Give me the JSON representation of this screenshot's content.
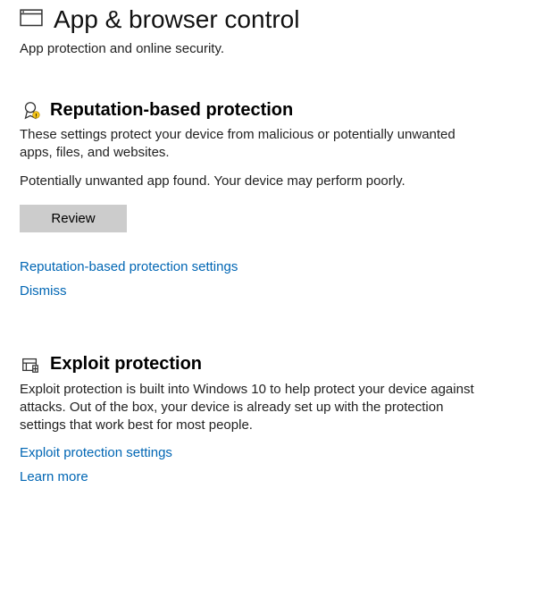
{
  "header": {
    "title": "App & browser control",
    "subtitle": "App protection and online security."
  },
  "reputation": {
    "title": "Reputation-based protection",
    "body": "These settings protect your device from malicious or potentially unwanted apps, files, and websites.",
    "status": "Potentially unwanted app found. Your device may perform poorly.",
    "review_button": "Review",
    "settings_link": "Reputation-based protection settings",
    "dismiss_link": "Dismiss"
  },
  "exploit": {
    "title": "Exploit protection",
    "body": "Exploit protection is built into Windows 10 to help protect your device against attacks.  Out of the box, your device is already set up with the protection settings that work best for most people.",
    "settings_link": "Exploit protection settings",
    "learn_more_link": "Learn more"
  }
}
